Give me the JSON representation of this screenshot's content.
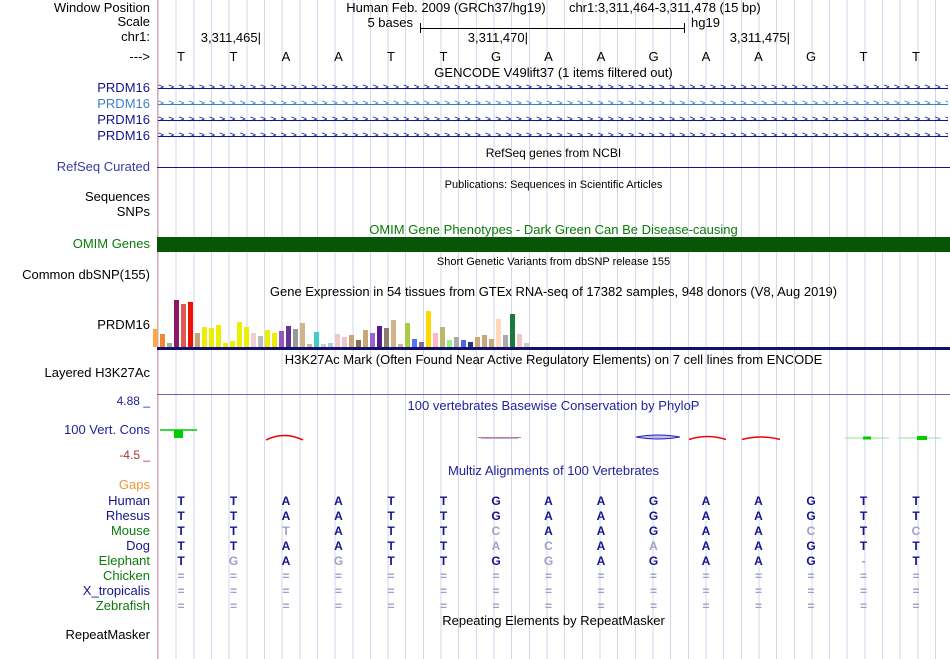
{
  "header": {
    "assembly_title": "Human Feb. 2009 (GRCh37/hg19)",
    "position_title": "chr1:3,311,464-3,311,478 (15 bp)",
    "window_position_label": "Window Position",
    "scale_label": "Scale",
    "scale_value": "5 bases",
    "scale_genome": "hg19",
    "chrom_label": "chr1:",
    "coord_labels": [
      "3,311,465|",
      "3,311,470|",
      "3,311,475|"
    ],
    "strand_arrow": "--->",
    "sequence": [
      "T",
      "T",
      "A",
      "A",
      "T",
      "T",
      "G",
      "A",
      "A",
      "G",
      "A",
      "A",
      "G",
      "T",
      "T"
    ]
  },
  "tracks": {
    "gencode": {
      "title": "GENCODE V49lift37 (1 items filtered out)",
      "genes": [
        {
          "label": "PRDM16",
          "color": "#14148C"
        },
        {
          "label": "PRDM16",
          "color": "#3B82C4"
        },
        {
          "label": "PRDM16",
          "color": "#14148C"
        },
        {
          "label": "PRDM16",
          "color": "#14148C"
        }
      ]
    },
    "refseq": {
      "title": "RefSeq genes from NCBI",
      "label": "RefSeq Curated"
    },
    "publications": {
      "title": "Publications: Sequences in Scientific Articles",
      "label": "Sequences"
    },
    "snps": {
      "label": "SNPs"
    },
    "omim": {
      "title": "OMIM Gene Phenotypes - Dark Green Can Be Disease-causing",
      "label": "OMIM Genes",
      "bar_color": "#075607"
    },
    "dbsnp": {
      "title": "Short Genetic Variants from dbSNP release 155",
      "label": "Common dbSNP(155)"
    },
    "gtex": {
      "title": "Gene Expression in 54 tissues from GTEx RNA-seq of 17382 samples, 948 donors (V8, Aug 2019)",
      "label": "PRDM16"
    },
    "h3k27ac": {
      "title": "H3K27Ac Mark (Often Found Near Active Regulatory Elements) on 7 cell lines from ENCODE",
      "label": "Layered H3K27Ac",
      "line_color": "#7D5FB2"
    },
    "cons": {
      "title": "100 vertebrates Basewise Conservation by PhyloP",
      "label": "100 Vert. Cons",
      "max": "4.88 _",
      "min": "-4.5 _"
    },
    "multiz": {
      "title": "Multiz Alignments of 100 Vertebrates"
    },
    "repeat": {
      "title": "Repeating Elements by RepeatMasker",
      "label": "RepeatMasker"
    }
  },
  "alignment": {
    "rows": [
      {
        "name": "Gaps",
        "color": "#EE9933",
        "cells": [],
        "dim": []
      },
      {
        "name": "Human",
        "color": "#14148C",
        "cells": [
          "T",
          "T",
          "A",
          "A",
          "T",
          "T",
          "G",
          "A",
          "A",
          "G",
          "A",
          "A",
          "G",
          "T",
          "T"
        ],
        "dim": []
      },
      {
        "name": "Rhesus",
        "color": "#14148C",
        "cells": [
          "T",
          "T",
          "A",
          "A",
          "T",
          "T",
          "G",
          "A",
          "A",
          "G",
          "A",
          "A",
          "G",
          "T",
          "T"
        ],
        "dim": []
      },
      {
        "name": "Mouse",
        "color": "#0B7A0B",
        "cells": [
          "T",
          "T",
          "T",
          "A",
          "T",
          "T",
          "C",
          "A",
          "A",
          "G",
          "A",
          "A",
          "C",
          "T",
          "C"
        ],
        "dim": [
          2,
          6,
          12,
          14
        ]
      },
      {
        "name": "Dog",
        "color": "#14148C",
        "cells": [
          "T",
          "T",
          "A",
          "A",
          "T",
          "T",
          "A",
          "C",
          "A",
          "A",
          "A",
          "A",
          "G",
          "T",
          "T"
        ],
        "dim": [
          6,
          7,
          9
        ]
      },
      {
        "name": "Elephant",
        "color": "#0B7A0B",
        "cells": [
          "T",
          "G",
          "A",
          "G",
          "T",
          "T",
          "G",
          "G",
          "A",
          "G",
          "A",
          "A",
          "G",
          "-",
          "T"
        ],
        "dim": [
          1,
          3,
          7,
          13
        ]
      },
      {
        "name": "Chicken",
        "color": "#0B7A0B",
        "cells": [
          "=",
          "=",
          "=",
          "=",
          "=",
          "=",
          "=",
          "=",
          "=",
          "=",
          "=",
          "=",
          "=",
          "=",
          "="
        ],
        "dim": [
          0,
          1,
          2,
          3,
          4,
          5,
          6,
          7,
          8,
          9,
          10,
          11,
          12,
          13,
          14
        ]
      },
      {
        "name": "X_tropicalis",
        "color": "#14148C",
        "cells": [
          "=",
          "=",
          "=",
          "=",
          "=",
          "=",
          "=",
          "=",
          "=",
          "=",
          "=",
          "=",
          "=",
          "=",
          "="
        ],
        "dim": [
          0,
          1,
          2,
          3,
          4,
          5,
          6,
          7,
          8,
          9,
          10,
          11,
          12,
          13,
          14
        ]
      },
      {
        "name": "Zebrafish",
        "color": "#0B7A0B",
        "cells": [
          "=",
          "=",
          "=",
          "=",
          "=",
          "=",
          "=",
          "=",
          "=",
          "=",
          "=",
          "=",
          "=",
          "=",
          "="
        ],
        "dim": [
          0,
          1,
          2,
          3,
          4,
          5,
          6,
          7,
          8,
          9,
          10,
          11,
          12,
          13,
          14
        ]
      }
    ]
  },
  "chart_data": [
    {
      "type": "bar",
      "title": "Gene Expression in 54 tissues from GTEx RNA-seq of 17382 samples, 948 donors (V8, Aug 2019)",
      "gene": "PRDM16",
      "ylabel": "expression (relative bar height, no numeric axis shown)",
      "values": [
        18,
        13,
        4,
        47,
        43,
        45,
        14,
        20,
        19,
        22,
        4,
        6,
        25,
        20,
        14,
        11,
        17,
        14,
        16,
        21,
        18,
        24,
        3,
        15,
        3,
        4,
        13,
        10,
        12,
        7,
        17,
        14,
        21,
        19,
        27,
        3,
        24,
        8,
        5,
        36,
        14,
        20,
        7,
        10,
        7,
        5,
        10,
        12,
        8,
        28,
        12,
        33,
        13,
        4
      ],
      "colors": [
        "#FFA54F",
        "#EE8833",
        "#8FBC8F",
        "#8B1A62",
        "#E0584E",
        "#EE1100",
        "#C8A470",
        "#EEEE00",
        "#EEEE00",
        "#EEEE00",
        "#EEEE00",
        "#EEEE00",
        "#EEEE00",
        "#EEEE00",
        "#EECFCF",
        "#BBBBBB",
        "#EEEE00",
        "#EEEE00",
        "#9955BB",
        "#663399",
        "#999999",
        "#D2B48C",
        "#D2B48C",
        "#44CCCC",
        "#CCCCCC",
        "#AACCEE",
        "#EEC9C9",
        "#EEC9C9",
        "#C8A878",
        "#8B6F47",
        "#C8A878",
        "#9966CC",
        "#551A8B",
        "#8E7B6B",
        "#D2B48C",
        "#D2B48C",
        "#AACC44",
        "#5577EE",
        "#8866AA",
        "#FFD700",
        "#FFB6C1",
        "#BDB76B",
        "#99EE88",
        "#AAAAAA",
        "#5566DD",
        "#223388",
        "#C8A878",
        "#C8A878",
        "#C8A878",
        "#FFDAB9",
        "#AAAAAA",
        "#1A7A3C",
        "#EEC9C9",
        "#CCCCCC"
      ]
    },
    {
      "type": "area",
      "title": "100 vertebrates Basewise Conservation by PhyloP",
      "ylim": [
        -4.5,
        4.88
      ],
      "marks": [
        {
          "x": "3,311,464",
          "direction": "positive",
          "color": "#00CC00"
        },
        {
          "x": "3,311,466",
          "direction": "negative",
          "color": "#EE0000"
        },
        {
          "x": "3,311,470",
          "direction": "flat",
          "color": "#CC7777"
        },
        {
          "x": "3,311,473",
          "direction": "negative",
          "color": "#2222CC"
        },
        {
          "x": "3,311,474",
          "direction": "negative",
          "color": "#EE0000"
        },
        {
          "x": "3,311,475",
          "direction": "negative",
          "color": "#EE0000"
        },
        {
          "x": "3,311,477",
          "direction": "positive",
          "color": "#00CC00"
        },
        {
          "x": "3,311,478",
          "direction": "positive",
          "color": "#00CC00"
        }
      ]
    }
  ]
}
